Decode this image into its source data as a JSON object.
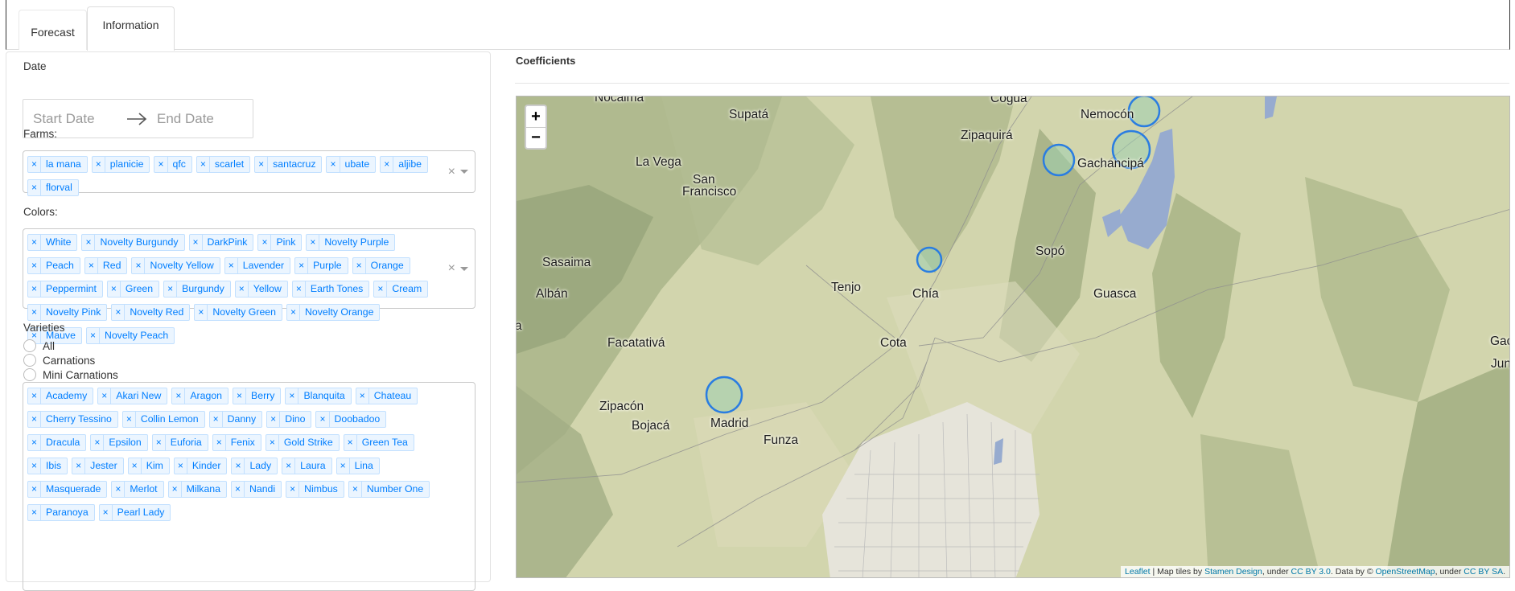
{
  "tabs": [
    {
      "label": "Forecast",
      "active": false
    },
    {
      "label": "Information",
      "active": true
    }
  ],
  "filters": {
    "date_label": "Date",
    "start_placeholder": "Start Date",
    "end_placeholder": "End Date",
    "farms_label": "Farms:",
    "farms": [
      "la mana",
      "planicie",
      "qfc",
      "scarlet",
      "santacruz",
      "ubate",
      "aljibe",
      "florval"
    ],
    "colors_label": "Colors:",
    "colors": [
      "White",
      "Novelty Burgundy",
      "DarkPink",
      "Pink",
      "Novelty Purple",
      "Peach",
      "Red",
      "Novelty Yellow",
      "Lavender",
      "Purple",
      "Orange",
      "Peppermint",
      "Green",
      "Burgundy",
      "Yellow",
      "Earth Tones",
      "Cream",
      "Novelty Pink",
      "Novelty Red",
      "Novelty Green",
      "Novelty Orange",
      "Mauve",
      "Novelty Peach"
    ],
    "varieties_label": "Varieties",
    "variety_options": [
      "All",
      "Carnations",
      "Mini Carnations"
    ],
    "varieties": [
      "Academy",
      "Akari New",
      "Aragon",
      "Berry",
      "Blanquita",
      "Chateau",
      "Cherry Tessino",
      "Collin Lemon",
      "Danny",
      "Dino",
      "Doobadoo",
      "Dracula",
      "Epsilon",
      "Euforia",
      "Fenix",
      "Gold Strike",
      "Green Tea",
      "Ibis",
      "Jester",
      "Kim",
      "Kinder",
      "Lady",
      "Laura",
      "Lina",
      "Masquerade",
      "Merlot",
      "Milkana",
      "Nandi",
      "Nimbus",
      "Number One",
      "Paranoya",
      "Pearl Lady"
    ],
    "remove_glyph": "×",
    "clear_glyph": "×"
  },
  "coefficients": {
    "title": "Coefficients",
    "zoom_in": "+",
    "zoom_out": "−",
    "places": [
      "Nocaima",
      "Supatá",
      "Cogua",
      "Nemocón",
      "Zipaquirá",
      "La Vega",
      "Gachancipá",
      "San",
      "Francisco",
      "Sasaima",
      "Sopó",
      "Albán",
      "Tenjo",
      "Chía",
      "Guasca",
      "Facatativá",
      "Cota",
      "Gacl",
      "Jun",
      "a",
      "Zipacón",
      "Bojacá",
      "Madrid",
      "Funza"
    ],
    "attribution": {
      "leaflet": "Leaflet",
      "sep1": " | Map tiles by ",
      "stamen": "Stamen Design",
      "sep2": ", under ",
      "ccby": "CC BY 3.0",
      "sep3": ". Data by © ",
      "osm": "OpenStreetMap",
      "sep4": ", under ",
      "ccbysa": "CC BY SA",
      "end": "."
    },
    "marker_color": "#2a7de1"
  }
}
